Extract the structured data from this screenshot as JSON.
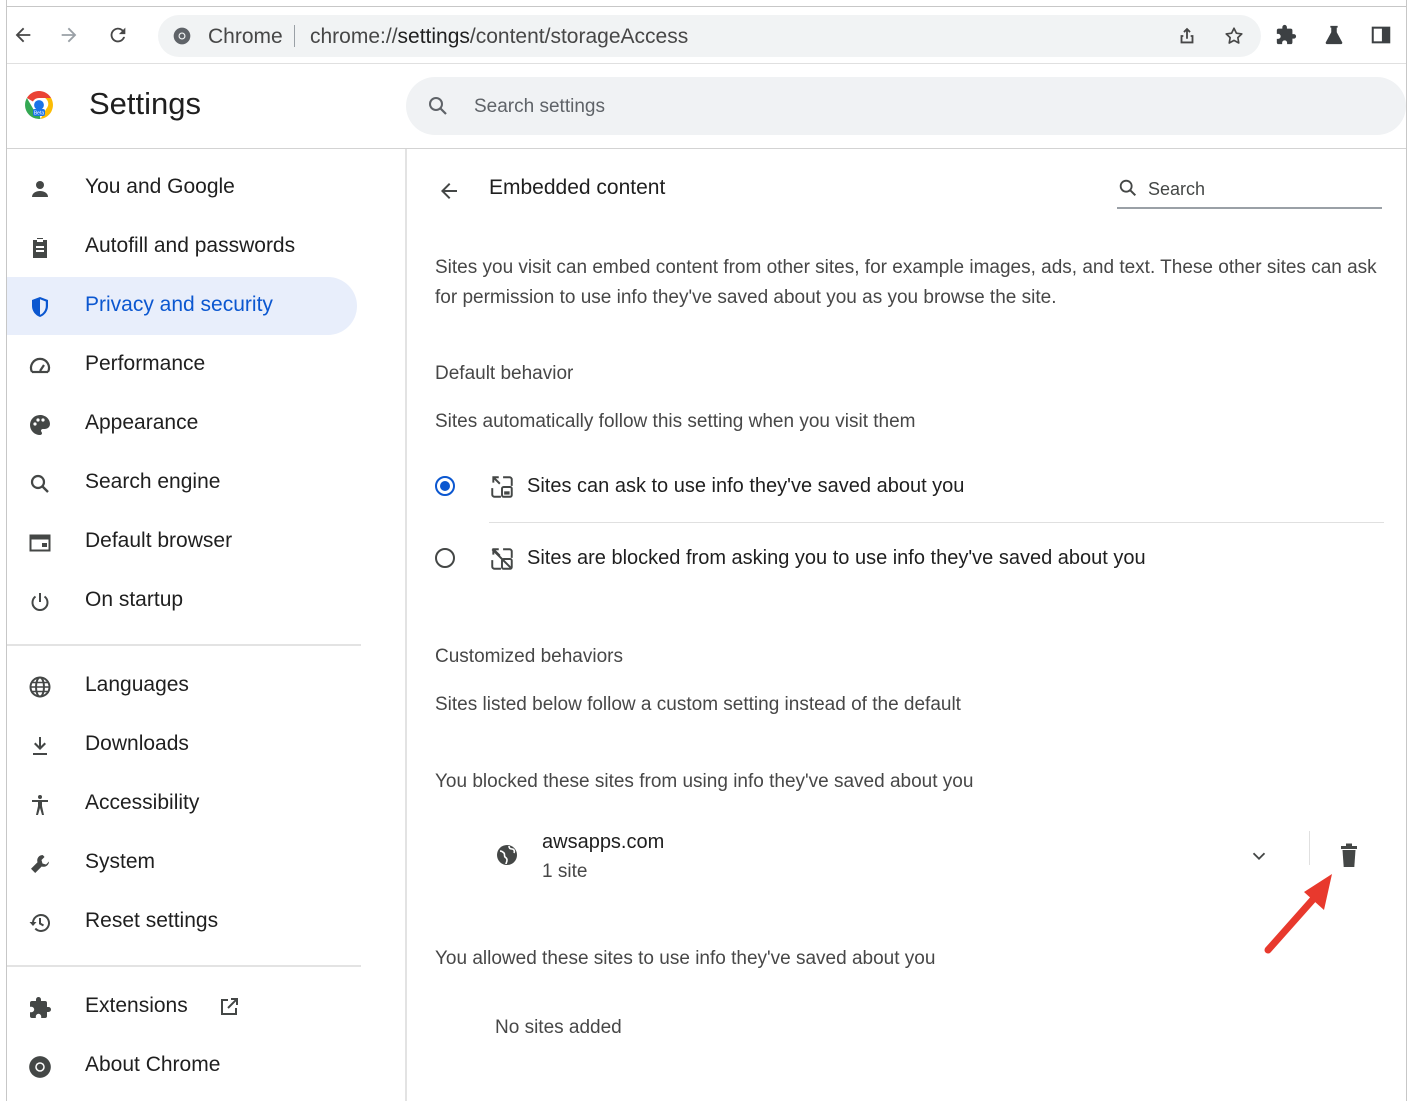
{
  "browser": {
    "omnibox_label": "Chrome",
    "url_prefix": "chrome://",
    "url_host": "settings",
    "url_path": "/content/storageAccess"
  },
  "header": {
    "title": "Settings",
    "search_placeholder": "Search settings"
  },
  "sidebar": {
    "items": [
      {
        "label": "You and Google",
        "icon": "person-icon"
      },
      {
        "label": "Autofill and passwords",
        "icon": "clipboard-icon"
      },
      {
        "label": "Privacy and security",
        "icon": "shield-icon",
        "active": true
      },
      {
        "label": "Performance",
        "icon": "speedometer-icon"
      },
      {
        "label": "Appearance",
        "icon": "palette-icon"
      },
      {
        "label": "Search engine",
        "icon": "search-icon"
      },
      {
        "label": "Default browser",
        "icon": "browser-window-icon"
      },
      {
        "label": "On startup",
        "icon": "power-icon"
      },
      {
        "label": "Languages",
        "icon": "globe-icon"
      },
      {
        "label": "Downloads",
        "icon": "download-icon"
      },
      {
        "label": "Accessibility",
        "icon": "accessibility-icon"
      },
      {
        "label": "System",
        "icon": "wrench-icon"
      },
      {
        "label": "Reset settings",
        "icon": "history-icon"
      },
      {
        "label": "Extensions",
        "icon": "puzzle-icon"
      },
      {
        "label": "About Chrome",
        "icon": "chrome-icon"
      }
    ]
  },
  "main": {
    "page_title": "Embedded content",
    "search_placeholder": "Search",
    "description": "Sites you visit can embed content from other sites, for example images, ads, and text. These other sites can ask for permission to use info they've saved about you as you browse the site.",
    "default_behavior": {
      "heading": "Default behavior",
      "subtitle": "Sites automatically follow this setting when you visit them",
      "options": [
        {
          "label": "Sites can ask to use info they've saved about you",
          "checked": true
        },
        {
          "label": "Sites are blocked from asking you to use info they've saved about you",
          "checked": false
        }
      ]
    },
    "customized_behaviors": {
      "heading": "Customized behaviors",
      "subtitle": "Sites listed below follow a custom setting instead of the default",
      "blocked_heading": "You blocked these sites from using info they've saved about you",
      "blocked_sites": [
        {
          "name": "awsapps.com",
          "count": "1 site"
        }
      ],
      "allowed_heading": "You allowed these sites to use info they've saved about you",
      "allowed_empty": "No sites added"
    }
  },
  "colors": {
    "accent": "#0b57d0",
    "active_nav_bg": "#e8eefb",
    "annotation_arrow": "#e8392d"
  }
}
